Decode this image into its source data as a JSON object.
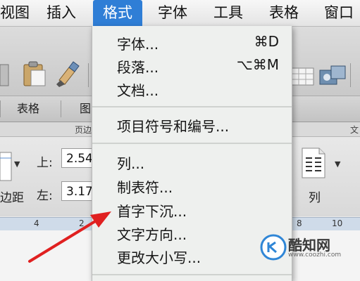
{
  "menubar": {
    "items": [
      "视图",
      "插入",
      "格式",
      "字体",
      "工具",
      "表格",
      "窗口"
    ],
    "active_index": 2
  },
  "ribbon": {
    "tabs": [
      "表格",
      "图"
    ],
    "group_labels": [
      "页边",
      "文"
    ],
    "top_label": "上:",
    "left_label": "左:",
    "top_value": "2.54",
    "left_value": "3.17",
    "margins_label": "边距",
    "columns_label": "列"
  },
  "ruler": {
    "ticks": [
      "4",
      "2",
      "8",
      "10"
    ]
  },
  "format_menu": {
    "groups": [
      [
        {
          "label": "字体...",
          "shortcut": "⌘D"
        },
        {
          "label": "段落...",
          "shortcut": "⌥⌘M"
        },
        {
          "label": "文档...",
          "shortcut": ""
        }
      ],
      [
        {
          "label": "项目符号和编号...",
          "shortcut": ""
        }
      ],
      [
        {
          "label": "列...",
          "shortcut": ""
        },
        {
          "label": "制表符...",
          "shortcut": ""
        },
        {
          "label": "首字下沉...",
          "shortcut": ""
        },
        {
          "label": "文字方向...",
          "shortcut": ""
        },
        {
          "label": "更改大小写...",
          "shortcut": ""
        }
      ]
    ]
  },
  "watermark": {
    "name": "酷知网",
    "url": "www.coozhi.com"
  },
  "colors": {
    "menu_highlight": "#2f7ed6",
    "arrow": "#e02020"
  }
}
